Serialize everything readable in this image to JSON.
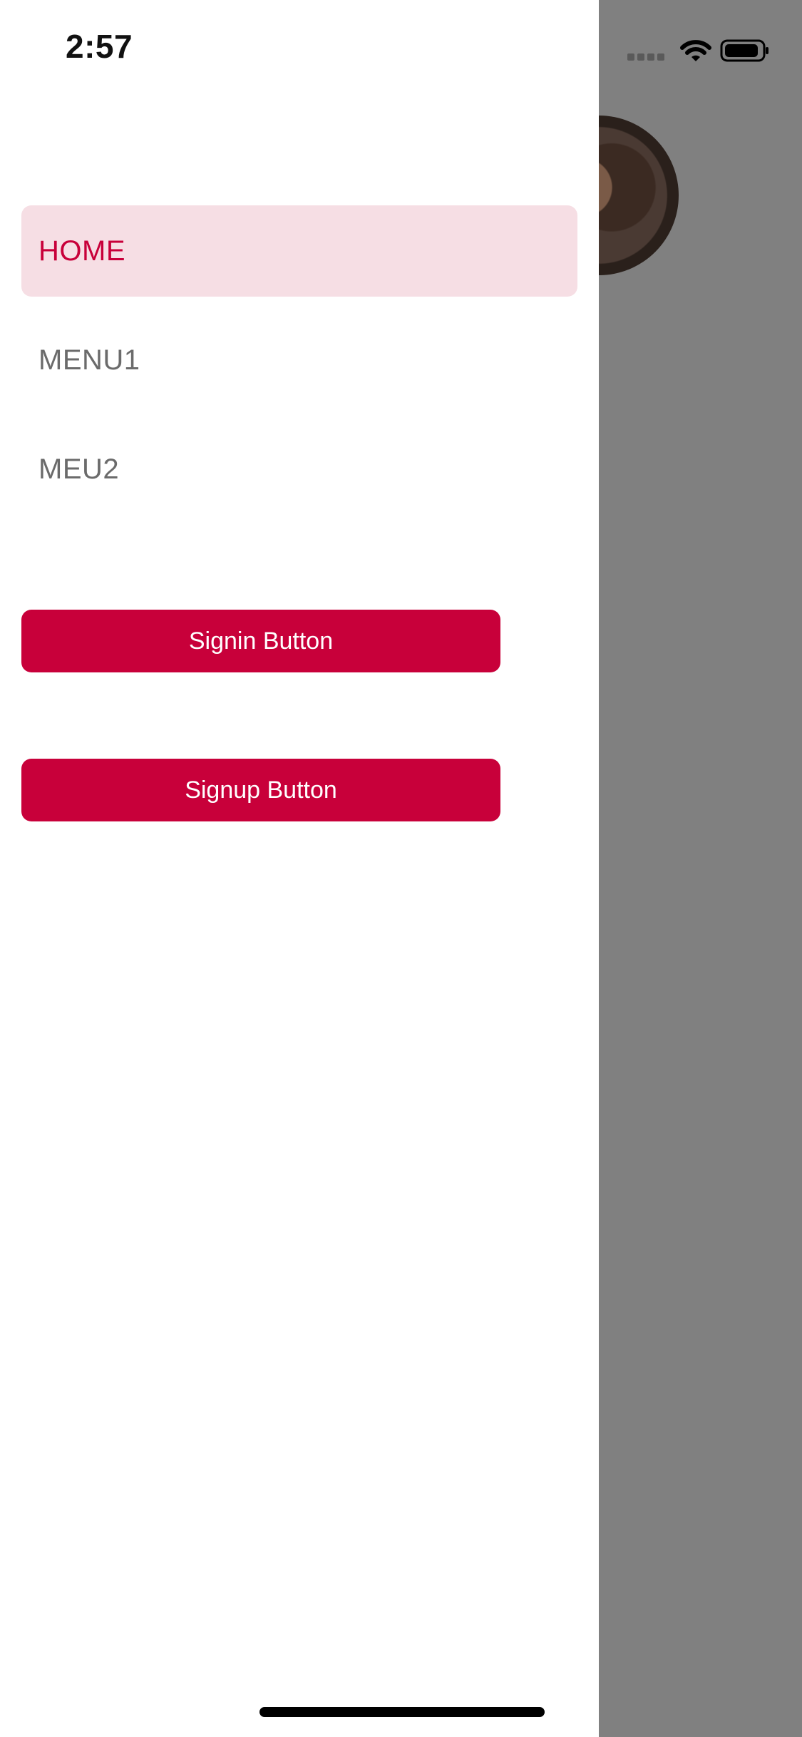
{
  "status_bar": {
    "time": "2:57"
  },
  "menu": {
    "items": [
      {
        "label": "HOME",
        "active": true
      },
      {
        "label": "MENU1",
        "active": false
      },
      {
        "label": "MEU2",
        "active": false
      }
    ]
  },
  "buttons": {
    "signin_label": "Signin Button",
    "signup_label": "Signup Button"
  },
  "colors": {
    "accent": "#c8003a",
    "active_background": "#f6dee4",
    "menu_text": "#6b6b6b",
    "overlay": "#808080",
    "background": "#ffffff"
  },
  "icons": {
    "cellular": "cellular-signal-icon",
    "wifi": "wifi-icon",
    "battery": "battery-icon",
    "avatar": "avatar"
  }
}
